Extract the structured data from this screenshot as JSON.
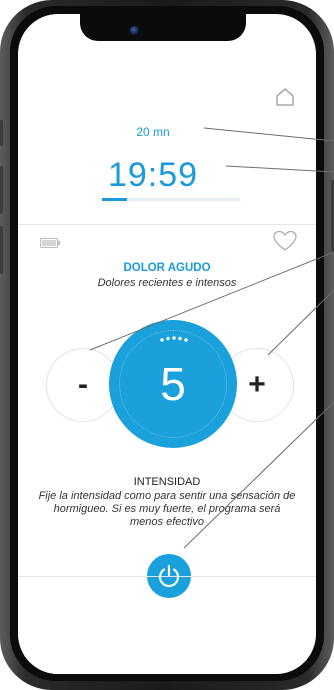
{
  "header": {
    "duration": "20 mn",
    "timer": "19:59",
    "progress_fraction": 0.18
  },
  "program": {
    "title": "DOLOR AGUDO",
    "subtitle": "Dolores recientes e intensos"
  },
  "controls": {
    "minus_label": "-",
    "plus_label": "+",
    "intensity_value": "5"
  },
  "intensity": {
    "title": "INTENSIDAD",
    "description": "Fije la intensidad como para sentir una sensación de hormigueo.  Si es muy fuerte, el programa será menos efectivo"
  },
  "icons": {
    "home": "home-icon",
    "battery": "battery-icon",
    "heart": "heart-icon",
    "power": "power-icon"
  },
  "colors": {
    "accent": "#1aa0db",
    "text_accent": "#1a9ad8"
  }
}
